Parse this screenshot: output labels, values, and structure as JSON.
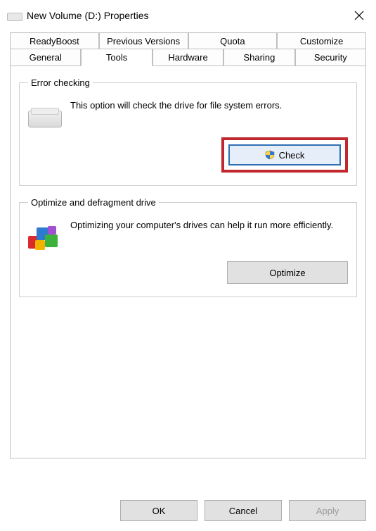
{
  "window": {
    "title": "New Volume (D:) Properties"
  },
  "tabs_row1": {
    "readyboost": "ReadyBoost",
    "previous": "Previous Versions",
    "quota": "Quota",
    "customize": "Customize"
  },
  "tabs_row2": {
    "general": "General",
    "tools": "Tools",
    "hardware": "Hardware",
    "sharing": "Sharing",
    "security": "Security"
  },
  "error_checking": {
    "legend": "Error checking",
    "desc": "This option will check the drive for file system errors.",
    "button": "Check"
  },
  "optimize": {
    "legend": "Optimize and defragment drive",
    "desc": "Optimizing your computer's drives can help it run more efficiently.",
    "button": "Optimize"
  },
  "footer": {
    "ok": "OK",
    "cancel": "Cancel",
    "apply": "Apply"
  }
}
